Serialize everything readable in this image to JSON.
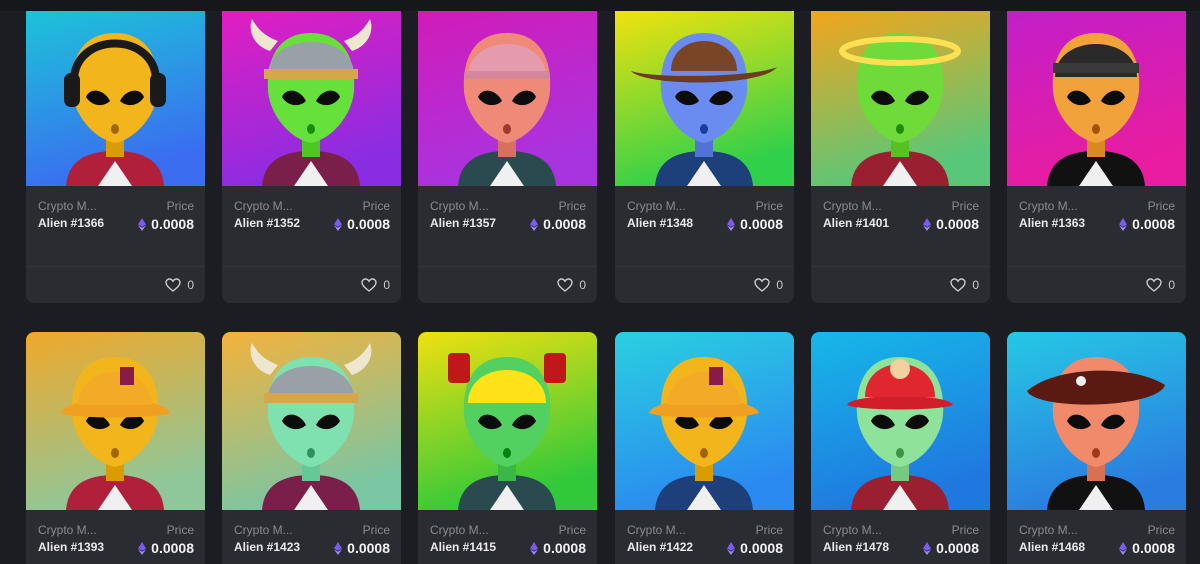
{
  "rows": [
    [
      {
        "collection": "Crypto M...",
        "price_label": "Price",
        "name": "Alien #1366",
        "price": "0.0008",
        "likes": "0",
        "bg": [
          "#1cc4d8",
          "#3a6df0"
        ],
        "skin": "#f2b51c",
        "headwear": "headphones-icon"
      },
      {
        "collection": "Crypto M...",
        "price_label": "Price",
        "name": "Alien #1352",
        "price": "0.0008",
        "likes": "0",
        "bg": [
          "#e21ec0",
          "#8a2de2"
        ],
        "skin": "#66e03a",
        "headwear": "viking-helmet-icon"
      },
      {
        "collection": "Crypto M...",
        "price_label": "Price",
        "name": "Alien #1357",
        "price": "0.0008",
        "likes": "0",
        "bg": [
          "#d21bb8",
          "#a834e0"
        ],
        "skin": "#f08a78",
        "headwear": "cap-icon"
      },
      {
        "collection": "Crypto M...",
        "price_label": "Price",
        "name": "Alien #1348",
        "price": "0.0008",
        "likes": "0",
        "bg": [
          "#f0e20e",
          "#31d04a"
        ],
        "skin": "#6a8cf0",
        "headwear": "cowboy-hat-icon"
      },
      {
        "collection": "Crypto M...",
        "price_label": "Price",
        "name": "Alien #1401",
        "price": "0.0008",
        "likes": "0",
        "bg": [
          "#f4a51c",
          "#58c77a"
        ],
        "skin": "#6edb3a",
        "headwear": "halo-icon"
      },
      {
        "collection": "Crypto M...",
        "price_label": "Price",
        "name": "Alien #1363",
        "price": "0.0008",
        "likes": "0",
        "bg": [
          "#c21fc9",
          "#e81da0"
        ],
        "skin": "#f2a23a",
        "headwear": "bandana-icon"
      }
    ],
    [
      {
        "collection": "Crypto M...",
        "price_label": "Price",
        "name": "Alien #1393",
        "price": "0.0008",
        "bg": [
          "#f0a82a",
          "#8fc79a"
        ],
        "skin": "#f2b51c",
        "headwear": "bucket-hat-icon"
      },
      {
        "collection": "Crypto M...",
        "price_label": "Price",
        "name": "Alien #1423",
        "price": "0.0008",
        "bg": [
          "#f4b23c",
          "#7bc6a3"
        ],
        "skin": "#7fe0b0",
        "headwear": "viking-helmet-icon"
      },
      {
        "collection": "Crypto M...",
        "price_label": "Price",
        "name": "Alien #1415",
        "price": "0.0008",
        "bg": [
          "#f0e010",
          "#31c93a"
        ],
        "skin": "#52d060",
        "headwear": "hard-hat-icon"
      },
      {
        "collection": "Crypto M...",
        "price_label": "Price",
        "name": "Alien #1422",
        "price": "0.0008",
        "bg": [
          "#2ad0e0",
          "#2a8af0"
        ],
        "skin": "#f2b51c",
        "headwear": "bucket-hat-icon"
      },
      {
        "collection": "Crypto M...",
        "price_label": "Price",
        "name": "Alien #1478",
        "price": "0.0008",
        "bg": [
          "#16b8e8",
          "#1f78e0"
        ],
        "skin": "#8fe29a",
        "headwear": "fire-helmet-icon"
      },
      {
        "collection": "Crypto M...",
        "price_label": "Price",
        "name": "Alien #1468",
        "price": "0.0008",
        "bg": [
          "#26c8e4",
          "#2a7de0"
        ],
        "skin": "#f08a6a",
        "headwear": "pirate-hat-icon"
      }
    ]
  ]
}
